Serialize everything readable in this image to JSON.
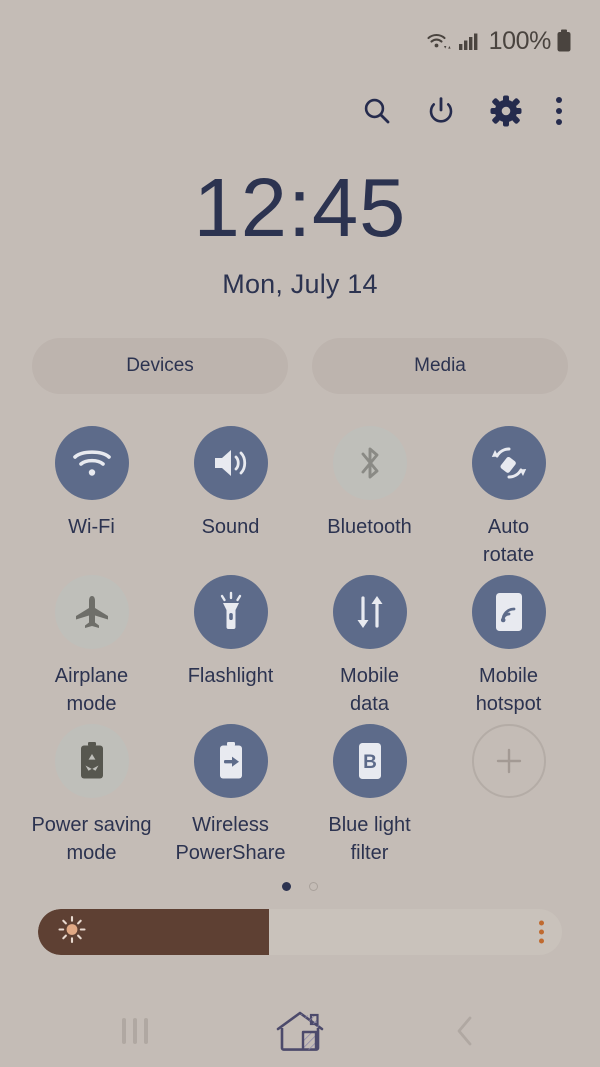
{
  "statusbar": {
    "wifi_icon": "wifi-data-icon",
    "signal_icon": "cellular-signal-icon",
    "battery_percent": "100%",
    "battery_icon": "battery-full-icon"
  },
  "header": {
    "search_icon": "search-icon",
    "power_icon": "power-icon",
    "settings_icon": "gear-icon",
    "more_icon": "more-vertical-icon"
  },
  "clock": {
    "time": "12:45",
    "date": "Mon, July 14"
  },
  "pills": [
    {
      "label": "Devices",
      "name": "devices-button"
    },
    {
      "label": "Media",
      "name": "media-button"
    }
  ],
  "toggles": [
    [
      {
        "label": "Wi-Fi",
        "icon": "wifi-icon",
        "active": true
      },
      {
        "label": "Sound",
        "icon": "sound-icon",
        "active": true
      },
      {
        "label": "Bluetooth",
        "icon": "bluetooth-icon",
        "active": false
      },
      {
        "label": "Auto\nrotate",
        "icon": "auto-rotate-icon",
        "active": true
      }
    ],
    [
      {
        "label": "Airplane\nmode",
        "icon": "airplane-icon",
        "active": false
      },
      {
        "label": "Flashlight",
        "icon": "flashlight-icon",
        "active": true
      },
      {
        "label": "Mobile\ndata",
        "icon": "mobile-data-icon",
        "active": true
      },
      {
        "label": "Mobile\nhotspot",
        "icon": "mobile-hotspot-icon",
        "active": true
      }
    ],
    [
      {
        "label": "Power saving\nmode",
        "icon": "power-saving-icon",
        "active": false
      },
      {
        "label": "Wireless\nPowerShare",
        "icon": "power-share-icon",
        "active": true
      },
      {
        "label": "Blue light\nfilter",
        "icon": "blue-light-icon",
        "active": true
      },
      {
        "label": "",
        "icon": "add-icon",
        "active": false,
        "add": true
      }
    ]
  ],
  "pagination": {
    "total": 2,
    "active_index": 0
  },
  "brightness": {
    "value_percent": 44,
    "sun_icon": "brightness-sun-icon",
    "more_icon": "brightness-more-icon"
  },
  "navbar": {
    "recents_icon": "recents-icon",
    "home_icon": "home-icon",
    "back_icon": "back-icon"
  },
  "colors": {
    "background": "#c4bcb6",
    "accent_navy": "#2c3350",
    "toggle_active": "#5d6b8a",
    "toggle_inactive": "#bfbfba",
    "slider_fill": "#5e4033",
    "slider_track": "#c9c2bb",
    "slider_accent": "#c06a30"
  }
}
